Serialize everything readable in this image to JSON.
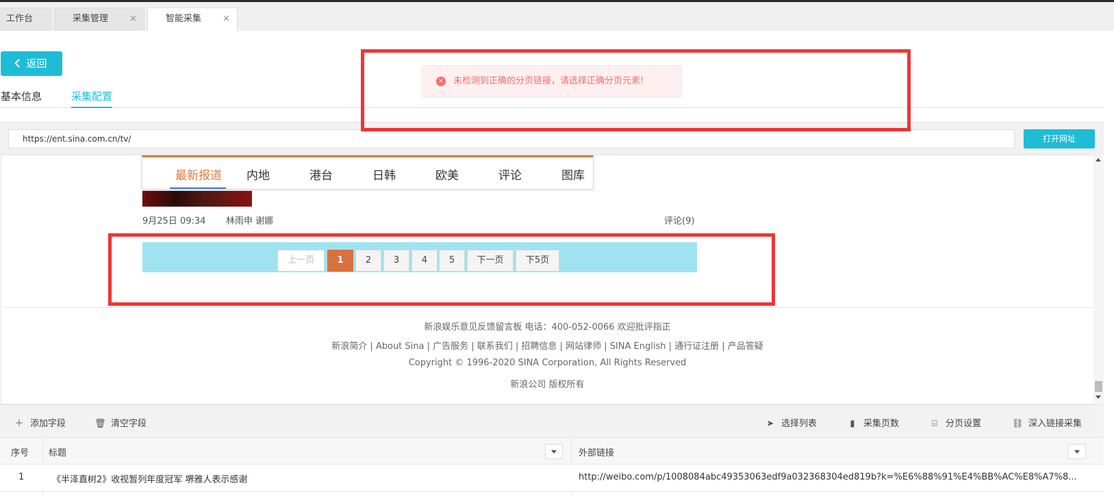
{
  "tabs": [
    {
      "label": "工作台",
      "closable": false
    },
    {
      "label": "采集管理",
      "closable": true
    },
    {
      "label": "智能采集",
      "closable": true,
      "active": true
    }
  ],
  "close_glyph": "×",
  "back_label": "返回",
  "subtabs": [
    "基本信息",
    "采集配置"
  ],
  "toast": {
    "message": "未检测到正确的分页链接，请选择正确分页元素!",
    "icon_glyph": "×"
  },
  "url": {
    "value": "https://ent.sina.com.cn/tv/",
    "open_label": "打开网址"
  },
  "preview": {
    "nav": [
      "最新报道",
      "内地",
      "港台",
      "日韩",
      "欧美",
      "评论",
      "图库"
    ],
    "meta": {
      "time": "9月25日 09:34",
      "authors": "林雨申  谢娜",
      "comments": "评论(9)"
    },
    "pager": {
      "prev": "上一页",
      "pages": [
        "1",
        "2",
        "3",
        "4",
        "5"
      ],
      "next": "下一页",
      "next5": "下5页",
      "current": "1"
    },
    "footer": [
      "新浪娱乐意见反馈留言板 电话：400-052-0066 欢迎批评指正",
      "新浪简介 | About Sina | 广告服务 | 联系我们 | 招聘信息 | 网站律师 | SINA English | 通行证注册 | 产品答疑",
      "Copyright © 1996-2020 SINA Corporation, All Rights Reserved",
      "新浪公司 版权所有"
    ]
  },
  "toolbar": {
    "add_field": "添加字段",
    "clear_fields": "清空字段",
    "select_list": "选择列表",
    "collect_pages": "采集页数",
    "pagination_settings": "分页设置",
    "deep_link": "深入链接采集"
  },
  "table": {
    "headers": [
      "序号",
      "标题",
      "外部链接"
    ],
    "rows": [
      {
        "index": "1",
        "title": "《半泽直树2》收视暂列年度冠军 堺雅人表示感谢",
        "link": "http://weibo.com/p/1008084abc49353063edf9a032368304ed819b?k=%E6%88%91%E4%BB%AC%E8%A7%8..."
      }
    ]
  },
  "colors": {
    "accent": "#1fbcd6",
    "error": "#f56c6c",
    "highlight_box": "#ef3535",
    "pager_current": "#d97040",
    "sina_orange": "#e07a3a"
  }
}
